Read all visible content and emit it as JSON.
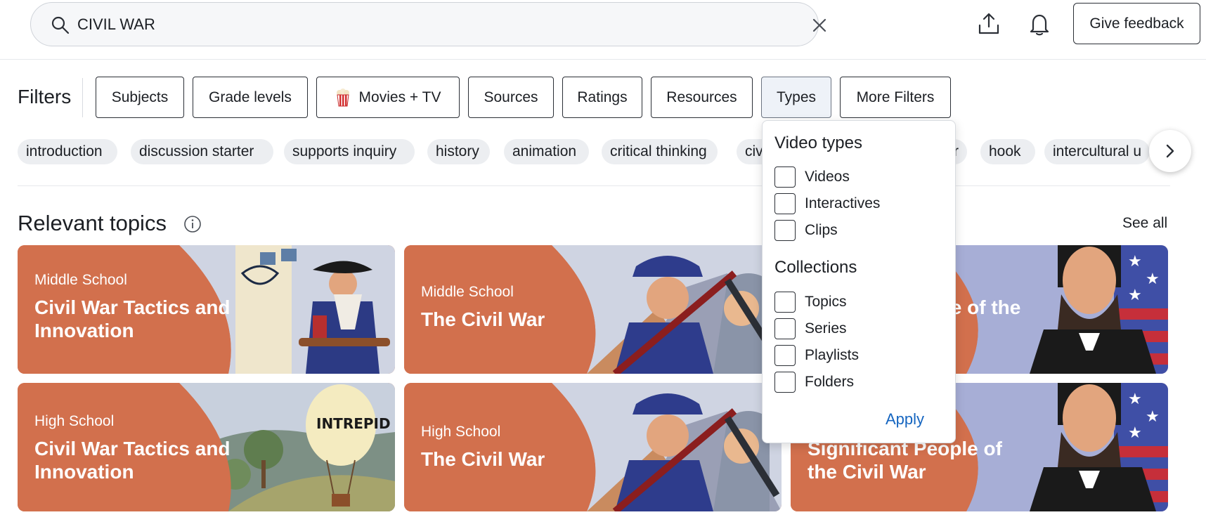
{
  "search": {
    "value": "CIVIL WAR",
    "placeholder": ""
  },
  "header": {
    "feedback_label": "Give feedback"
  },
  "filters": {
    "label": "Filters",
    "buttons": [
      "Subjects",
      "Grade levels",
      "Movies + TV",
      "Sources",
      "Ratings",
      "Resources",
      "Types",
      "More Filters"
    ],
    "active": "Types"
  },
  "tags": [
    "introduction",
    "discussion starter",
    "supports inquiry",
    "history",
    "animation",
    "critical thinking",
    "civ",
    "r",
    "hook",
    "intercultural u"
  ],
  "section": {
    "title": "Relevant topics",
    "see_all": "See all"
  },
  "cards": [
    {
      "level": "Middle School",
      "title": "Civil War Tactics and Innovation"
    },
    {
      "level": "Middle School",
      "title": "The Civil War"
    },
    {
      "level": "",
      "title": "le of the"
    },
    {
      "level": "High School",
      "title": "Civil War Tactics and Innovation"
    },
    {
      "level": "High School",
      "title": "The Civil War"
    },
    {
      "level": "",
      "title": "Significant People of the Civil War"
    }
  ],
  "dropdown": {
    "video_types_heading": "Video types",
    "video_types": [
      "Videos",
      "Interactives",
      "Clips"
    ],
    "collections_heading": "Collections",
    "collections": [
      "Topics",
      "Series",
      "Playlists",
      "Folders"
    ],
    "apply_label": "Apply"
  },
  "colors": {
    "card_bg": "#d2704d",
    "link": "#1565c0",
    "active_filter_bg": "#eef2f8"
  },
  "icons": [
    "search-icon",
    "close-icon",
    "share-icon",
    "bell-icon",
    "popcorn-icon",
    "chevron-right-icon",
    "info-icon"
  ]
}
